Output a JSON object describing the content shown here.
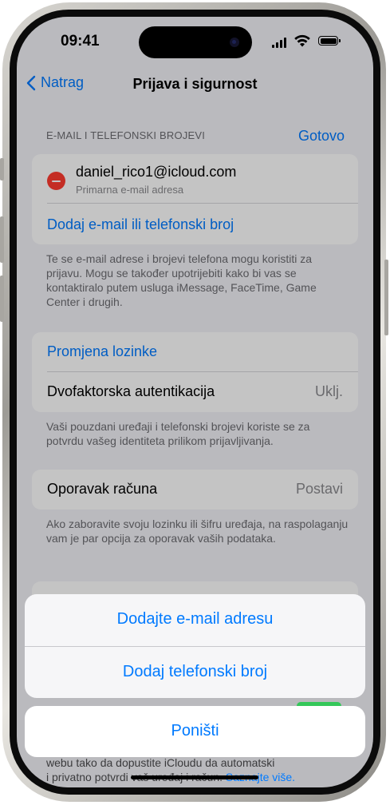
{
  "status_bar": {
    "time": "09:41"
  },
  "nav": {
    "back_label": "Natrag",
    "title": "Prijava i sigurnost"
  },
  "email_section": {
    "header": "E-MAIL I TELEFONSKI BROJEVI",
    "done_label": "Gotovo",
    "email": "daniel_rico1@icloud.com",
    "email_subtitle": "Primarna e-mail adresa",
    "add_link": "Dodaj e-mail ili telefonski broj",
    "footer": "Te se e-mail adrese i brojevi telefona mogu koristiti za prijavu. Mogu se također upotrijebiti kako bi vas se kontaktiralo putem usluga iMessage, FaceTime, Game Center i drugih."
  },
  "password_section": {
    "change_password": "Promjena lozinke",
    "two_factor_label": "Dvofaktorska autentikacija",
    "two_factor_value": "Uklj.",
    "footer": "Vaši pouzdani uređaji i telefonski brojevi koriste se za potvrdu vašeg identiteta prilikom prijavljivanja."
  },
  "recovery_section": {
    "label": "Oporavak računa",
    "value": "Postavi",
    "footer": "Ako zaboravite svoju lozinku ili šifru uređaja, na raspolaganju vam je par opcija za oporavak vaših podataka."
  },
  "bottom_footer": {
    "line1": "webu tako da dopustite iCloudu da automatski",
    "line2_prefix": "i privatno potvrdi vaš uređaj i račun.",
    "link": "Saznajte više."
  },
  "action_sheet": {
    "add_email": "Dodajte e-mail adresu",
    "add_phone": "Dodaj telefonski broj",
    "cancel": "Poništi"
  }
}
